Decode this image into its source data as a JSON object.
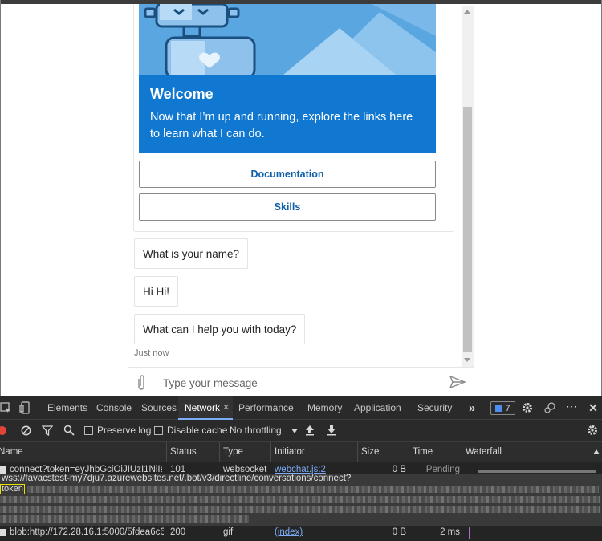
{
  "chat": {
    "welcome_title": "Welcome",
    "welcome_body": "Now that I’m up and running, explore the links here to learn what I can do.",
    "buttons": [
      "Documentation",
      "Skills"
    ],
    "messages": [
      "What is your name?",
      "Hi Hi!",
      "What can I help you with today?"
    ],
    "timestamp": "Just now",
    "input_placeholder": "Type your message"
  },
  "devtools": {
    "tabs": [
      "Elements",
      "Console",
      "Sources",
      "Network",
      "Performance",
      "Memory",
      "Application",
      "Security"
    ],
    "active_tab": "Network",
    "issues_count": "7",
    "toolbar": {
      "preserve_log": "Preserve log",
      "disable_cache": "Disable cache",
      "throttling": "No throttling"
    },
    "columns": [
      "Name",
      "Status",
      "Type",
      "Initiator",
      "Size",
      "Time",
      "Waterfall"
    ],
    "rows": [
      {
        "name": "connect?token=eyJhbGciOiJIUzI1NiIsI",
        "status": "101",
        "type": "websocket",
        "initiator": "webchat.js:2",
        "size": "0 B",
        "time": "Pending"
      },
      {
        "name": "blob:http://172.28.16.1:5000/5fdea6c6...",
        "status": "200",
        "type": "gif",
        "initiator": "(index)",
        "size": "0 B",
        "time": "2 ms"
      }
    ],
    "tooltip_url": "wss://favacstest-my7dju7.azurewebsites.net/.bot/v3/directline/conversations/connect?",
    "tooltip_param": "token",
    "colors": {
      "accent": "#7cacf8",
      "record": "#e0453a",
      "hero_blue": "#1078d0"
    }
  }
}
